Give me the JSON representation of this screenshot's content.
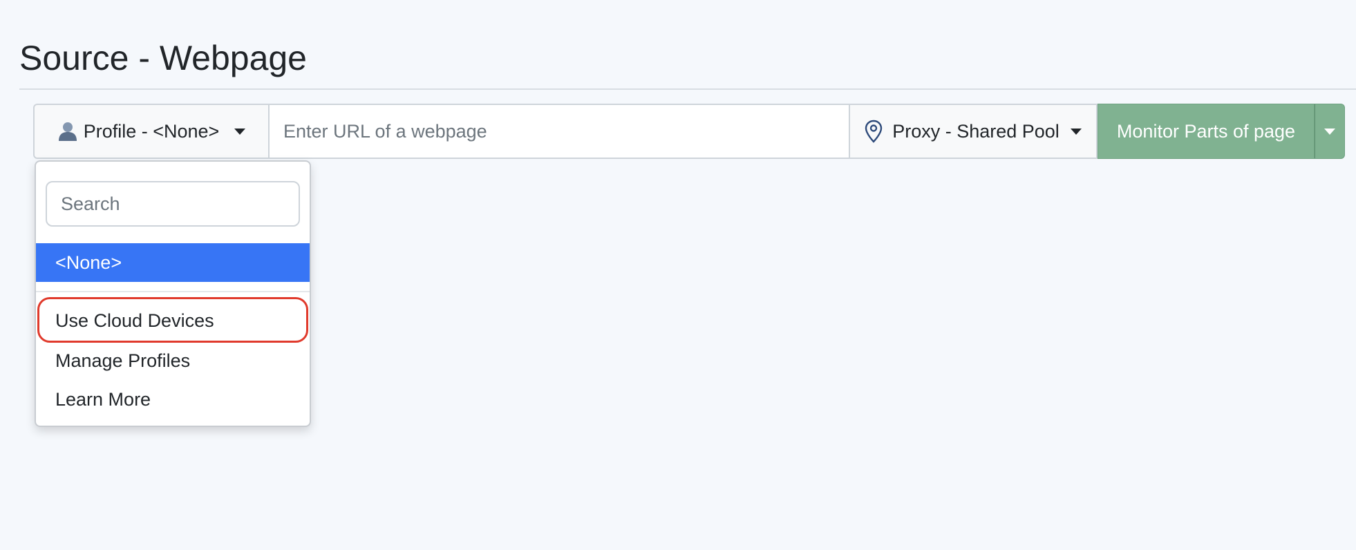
{
  "page": {
    "title": "Source - Webpage"
  },
  "toolbar": {
    "profile_label": "Profile - <None>",
    "profile_icon": "user-icon",
    "url_placeholder": "Enter URL of a webpage",
    "url_value": "",
    "proxy_label": "Proxy - Shared Pool",
    "proxy_icon": "location-pin-icon",
    "monitor_label": "Monitor Parts of page"
  },
  "profile_menu": {
    "search_placeholder": "Search",
    "search_value": "",
    "selected_item": "<None>",
    "items": [
      {
        "label": "Use Cloud Devices"
      },
      {
        "label": "Manage Profiles"
      },
      {
        "label": "Learn More"
      }
    ]
  },
  "colors": {
    "primary": "#3775f5",
    "success_muted": "#80b291",
    "highlight": "#e03a2c"
  }
}
